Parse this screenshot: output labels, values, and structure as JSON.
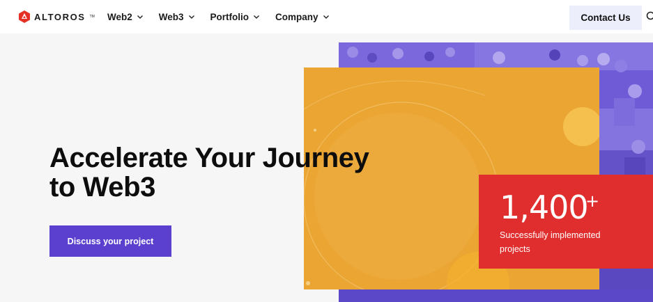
{
  "header": {
    "logo_text": "ALTOROS",
    "logo_tm": "TM",
    "nav": [
      {
        "label": "Web2"
      },
      {
        "label": "Web3"
      },
      {
        "label": "Portfolio"
      },
      {
        "label": "Company"
      }
    ],
    "contact_label": "Contact Us"
  },
  "hero": {
    "title_line1": "Accelerate Your Journey",
    "title_line2": "to Web3",
    "cta_label": "Discuss your project"
  },
  "stat": {
    "number": "1,400",
    "plus": "+",
    "caption": "Successfully implemented projects"
  },
  "colors": {
    "accent": "#5b3fcf",
    "yellow": "#eba533",
    "red": "#e02d2d",
    "photo_tint": "#6f5bd6",
    "contact_bg": "#eceefc"
  },
  "icons": {
    "logo": "altoros-logo-icon",
    "chevron": "chevron-down-icon",
    "search": "search-icon"
  }
}
